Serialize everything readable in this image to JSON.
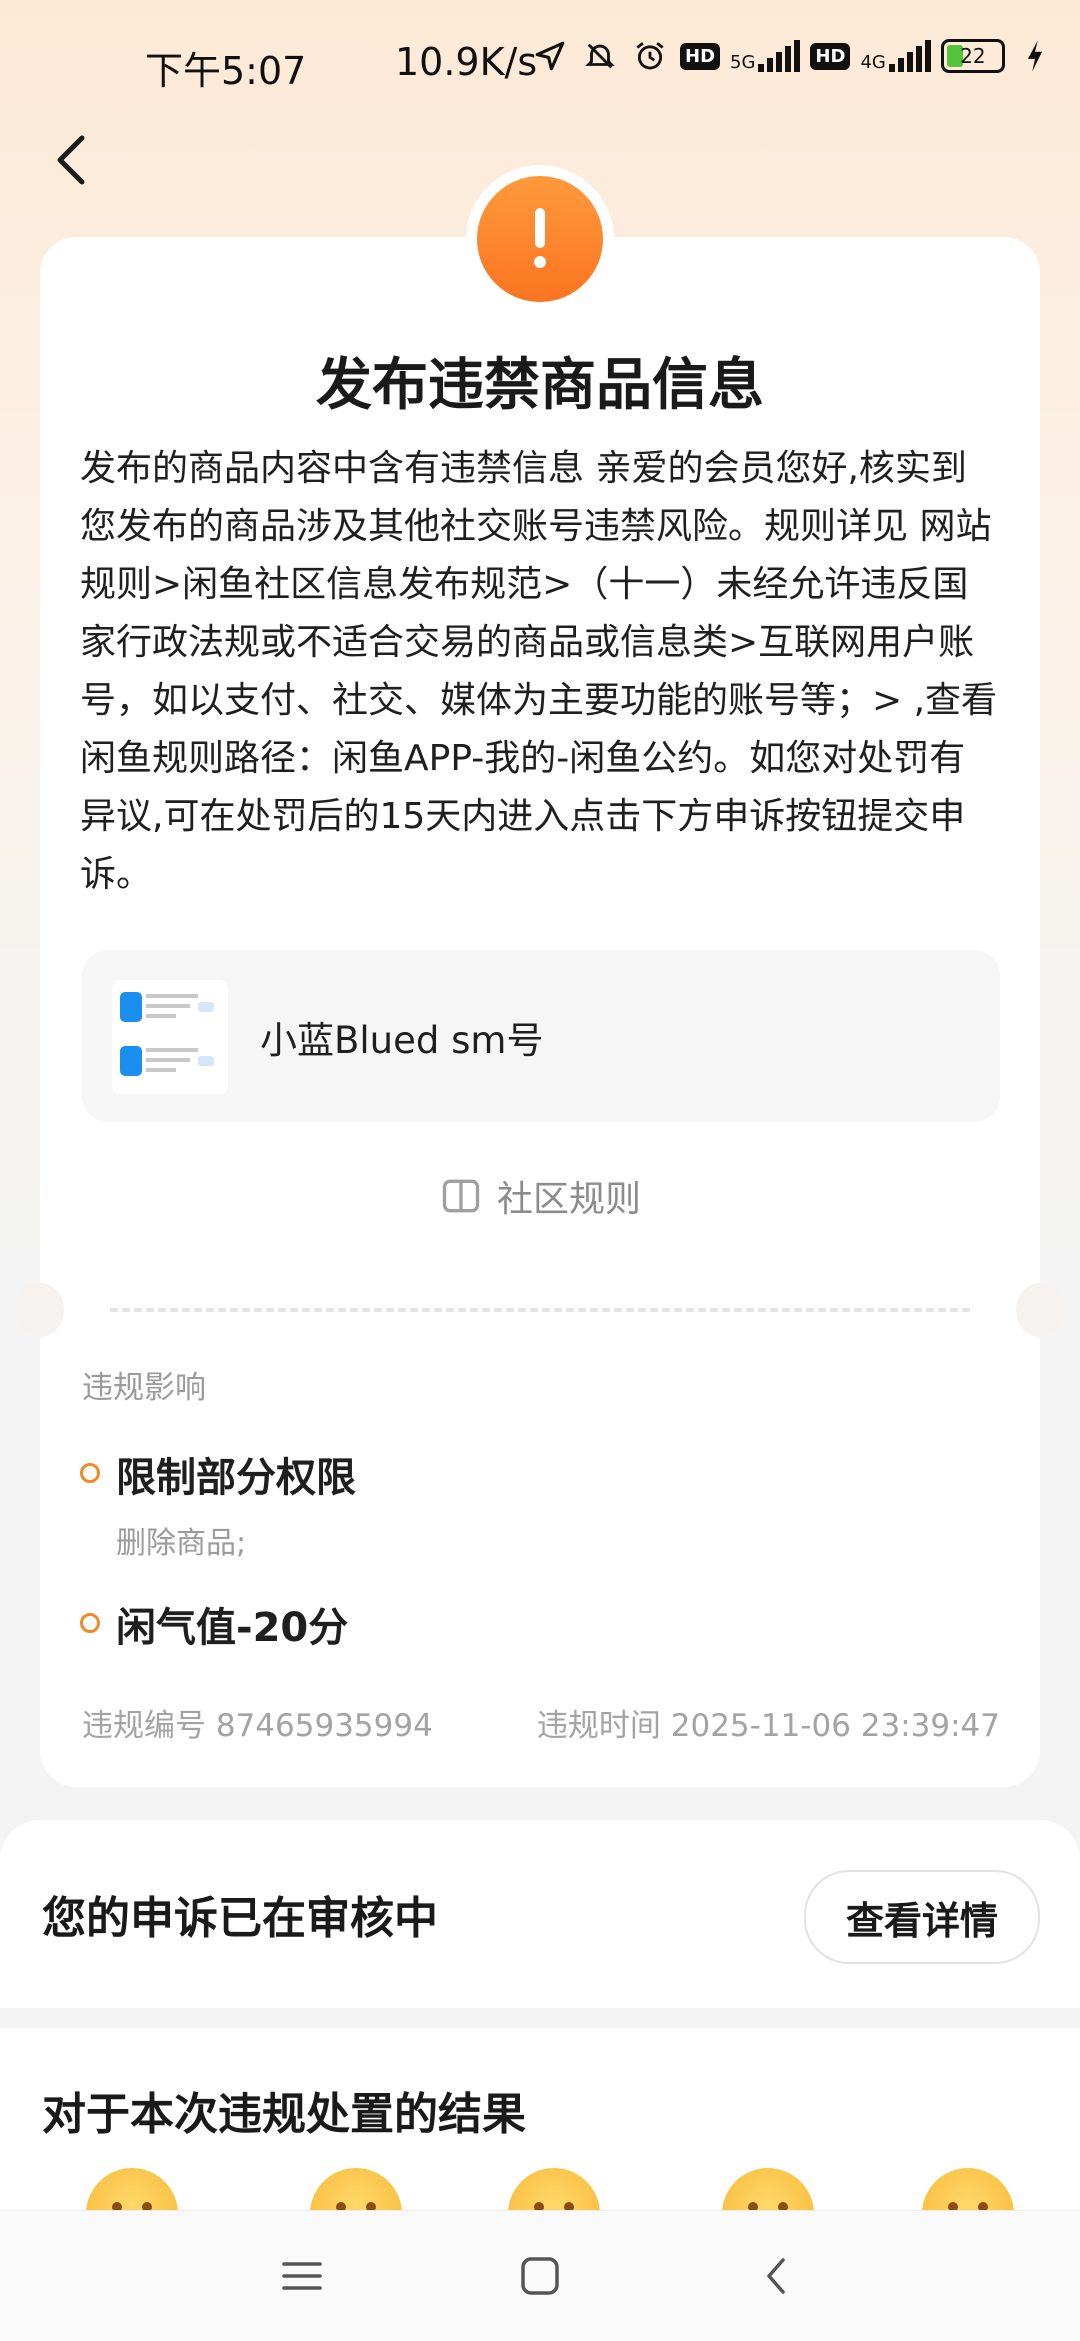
{
  "status_bar": {
    "time": "下午5:07",
    "net_speed": "10.9K/s",
    "signal1_label": "5G",
    "signal2_label": "4G",
    "hd_label": "HD",
    "battery": "22",
    "icons": [
      "location-arrow-icon",
      "mute-bell-icon",
      "alarm-icon",
      "hd-icon",
      "signal-5g-icon",
      "hd-icon",
      "signal-4g-icon",
      "battery-icon",
      "charging-icon"
    ]
  },
  "header": {
    "back_icon": "chevron-left-icon"
  },
  "notice": {
    "alert_icon": "exclamation-icon",
    "accent_color": "#fb7f2a",
    "title": "发布违禁商品信息",
    "description": "发布的商品内容中含有违禁信息 亲爱的会员您好,核实到您发布的商品涉及其他社交账号违禁风险。规则详见 网站规则>闲鱼社区信息发布规范>（十一）未经允许违反国家行政法规或不适合交易的商品或信息类>互联网用户账号，如以支付、社交、媒体为主要功能的账号等；> ,查看闲鱼规则路径：闲鱼APP-我的-闲鱼公约。如您对处罚有异议,可在处罚后的15天内进入点击下方申诉按钮提交申诉。",
    "item": {
      "title": "小蓝Blued sm号"
    },
    "rules_link": "社区规则",
    "impact_label": "违规影响",
    "impacts": [
      {
        "title": "限制部分权限",
        "sub": "删除商品;"
      },
      {
        "title": "闲气值-20分",
        "sub": ""
      }
    ],
    "violation_id": "违规编号 87465935994",
    "violation_time": "违规时间 2025-11-06 23:39:47"
  },
  "appeal": {
    "status": "您的申诉已在审核中",
    "detail_button": "查看详情"
  },
  "feedback": {
    "title": "对于本次违规处置的结果",
    "emoji_icons": [
      "angry-face-icon",
      "unamused-face-icon",
      "neutral-face-icon",
      "smiling-face-icon",
      "grinning-face-icon"
    ]
  },
  "navbar": {
    "icons": [
      "menu-icon",
      "home-square-icon",
      "back-icon"
    ]
  }
}
